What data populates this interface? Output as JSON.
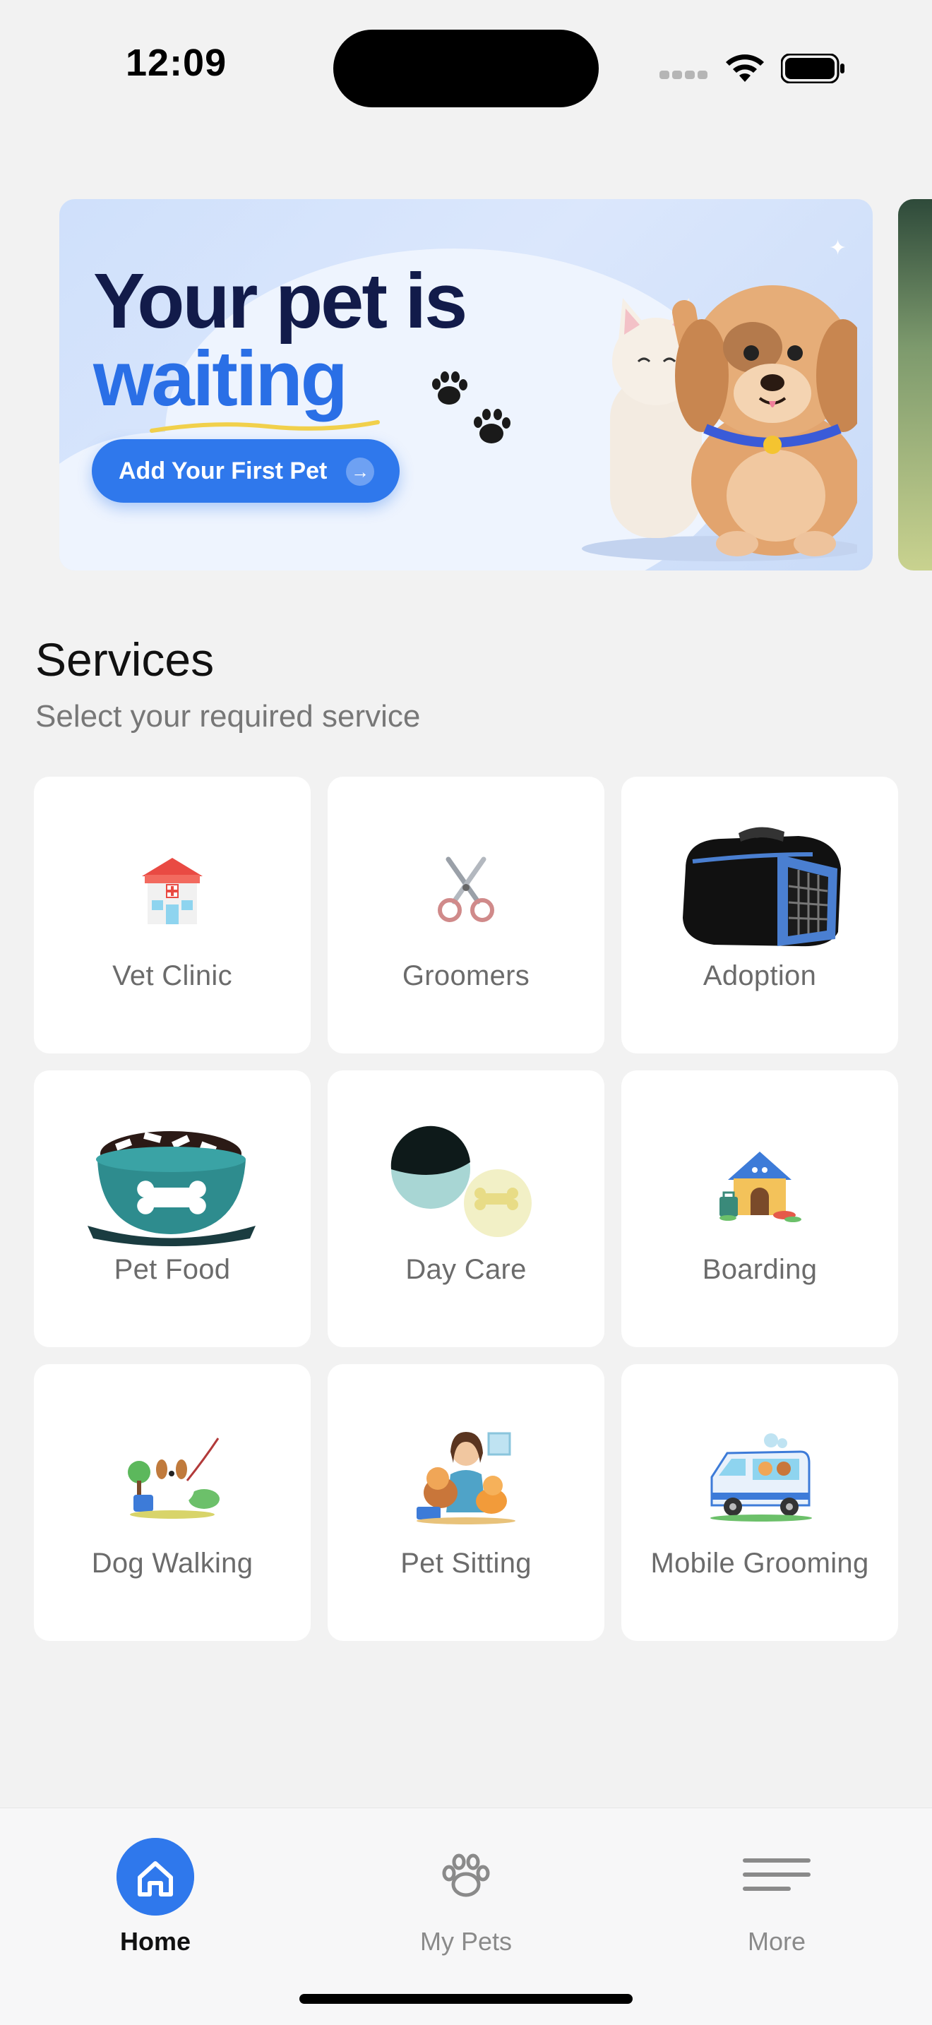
{
  "status_bar": {
    "time": "12:09",
    "icons": [
      "signal-icon",
      "wifi-icon",
      "battery-icon"
    ]
  },
  "banner": {
    "title_line1": "Your pet is",
    "title_line2": "waiting",
    "button_label": "Add Your First Pet",
    "button_icon": "arrow-right-icon",
    "colors": {
      "title": "#121b4a",
      "accent": "#2a6fe6",
      "button": "#2f78ec"
    }
  },
  "services": {
    "title": "Services",
    "subtitle": "Select your required service",
    "items": [
      {
        "label": "Vet Clinic",
        "icon": "vet-clinic-icon"
      },
      {
        "label": "Groomers",
        "icon": "scissors-icon"
      },
      {
        "label": "Adoption",
        "icon": "pet-carrier-icon"
      },
      {
        "label": "Pet Food",
        "icon": "food-bowl-icon"
      },
      {
        "label": "Day Care",
        "icon": "day-care-icon"
      },
      {
        "label": "Boarding",
        "icon": "pet-house-icon"
      },
      {
        "label": "Dog Walking",
        "icon": "dog-walking-icon"
      },
      {
        "label": "Pet Sitting",
        "icon": "pet-sitting-icon"
      },
      {
        "label": "Mobile Grooming",
        "icon": "grooming-van-icon"
      }
    ]
  },
  "tabbar": {
    "tabs": [
      {
        "label": "Home",
        "icon": "home-icon",
        "active": true
      },
      {
        "label": "My Pets",
        "icon": "paw-icon",
        "active": false
      },
      {
        "label": "More",
        "icon": "menu-icon",
        "active": false
      }
    ],
    "active_color": "#2f78ec"
  }
}
